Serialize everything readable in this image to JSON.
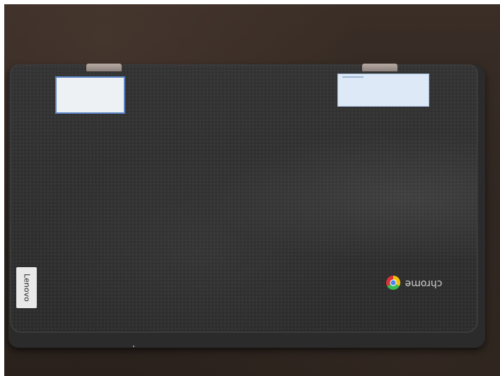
{
  "scene": {
    "subject": "laptop-lid-top-view",
    "colors": {
      "background_wood": "#2f2520",
      "lid": "#2e2e2e",
      "hinge": "#a89b95",
      "sticker_border": "#5b86c6",
      "inventory_sticker": "#dde9f7"
    }
  },
  "brand": {
    "lenovo_text": "Lenovo",
    "chrome_text": "chrome"
  },
  "asset_sticker": {
    "lines": [
      "",
      "",
      "",
      "",
      "",
      ""
    ]
  },
  "inventory_sticker": {
    "title": "",
    "code": "",
    "label_right": "",
    "footer": ""
  }
}
